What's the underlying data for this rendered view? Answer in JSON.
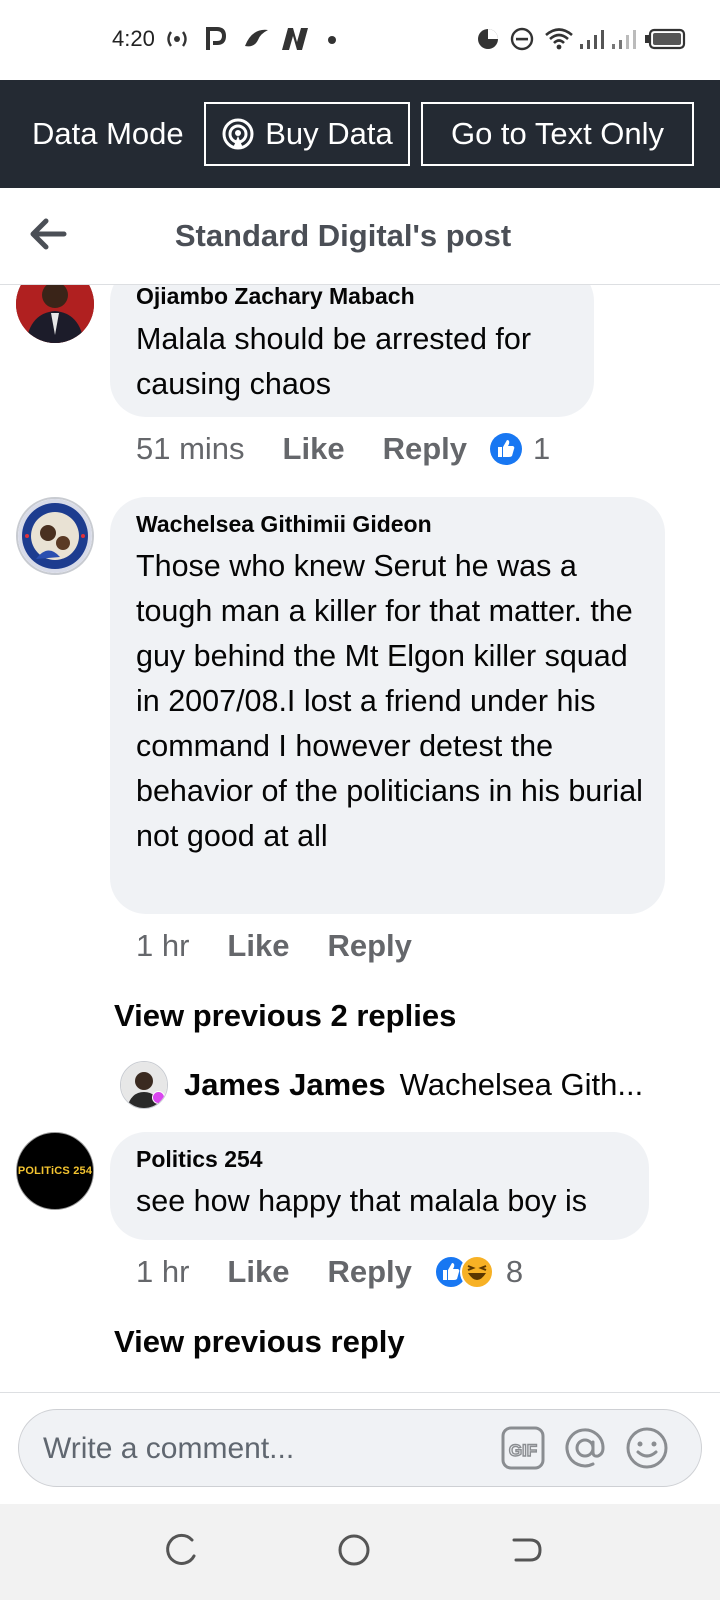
{
  "status_bar": {
    "time": "4:20"
  },
  "data_mode": {
    "label": "Data Mode",
    "buy_data": "Buy Data",
    "text_only": "Go to Text Only"
  },
  "header": {
    "title": "Standard Digital's post"
  },
  "comments": [
    {
      "author": "Ojiambo Zachary Mabach",
      "text": "Malala should be arrested for causing chaos",
      "time": "51 mins",
      "like": "Like",
      "reply": "Reply",
      "reaction_count": "1"
    },
    {
      "author": "Wachelsea Githimii Gideon",
      "text": "Those who knew Serut he was a tough man a killer for that matter. the guy behind the Mt Elgon killer squad in 2007/08.I lost a friend under his command I however detest the behavior of the politicians in his burial not good at all",
      "time": "1 hr",
      "like": "Like",
      "reply": "Reply",
      "view_previous": "View previous 2 replies",
      "reply_preview": {
        "author": "James James",
        "snippet": "Wachelsea Gith..."
      }
    },
    {
      "author": "Politics 254",
      "avatar_text": "POLITiCS 254",
      "text": "see how happy that malala boy is",
      "time": "1 hr",
      "like": "Like",
      "reply": "Reply",
      "reaction_count": "8",
      "view_previous": "View previous reply"
    }
  ],
  "composer": {
    "placeholder": "Write a comment..."
  },
  "colors": {
    "facebook_blue": "#1877f2",
    "bubble_bg": "#f0f2f5",
    "meta_gray": "#65676b",
    "datamode_bg": "#242a33"
  },
  "icons": [
    "wifi-icon",
    "signal-icon",
    "battery-icon",
    "back-arrow-icon",
    "gif-icon",
    "at-mention-icon",
    "emoji-icon",
    "like-reaction-icon",
    "haha-reaction-icon"
  ]
}
